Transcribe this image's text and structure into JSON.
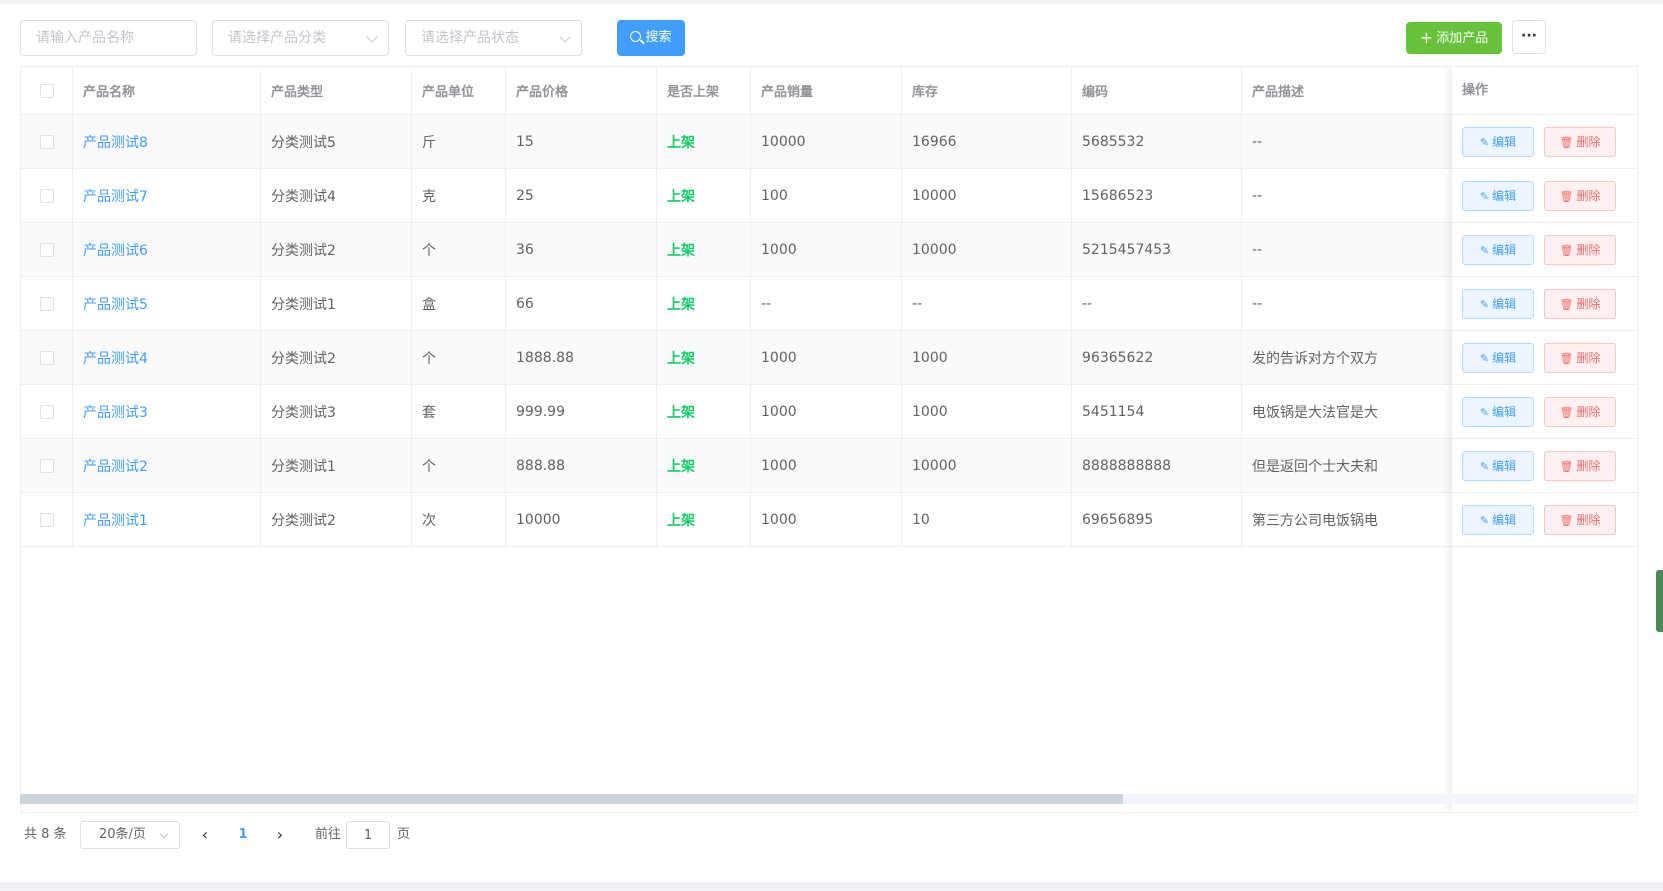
{
  "toolbar": {
    "name_placeholder": "请输入产品名称",
    "category_placeholder": "请选择产品分类",
    "status_placeholder": "请选择产品状态",
    "search_label": "搜索",
    "add_label": "添加产品",
    "more_label": "···"
  },
  "table": {
    "headers": [
      "产品名称",
      "产品类型",
      "产品单位",
      "产品价格",
      "是否上架",
      "产品销量",
      "库存",
      "编码",
      "产品描述",
      "操作"
    ],
    "edit_label": "编辑",
    "delete_label": "删除",
    "rows": [
      {
        "name": "产品测试8",
        "type": "分类测试5",
        "unit": "斤",
        "price": "15",
        "status": "上架",
        "sales": "10000",
        "stock": "16966",
        "code": "5685532",
        "desc": "--"
      },
      {
        "name": "产品测试7",
        "type": "分类测试4",
        "unit": "克",
        "price": "25",
        "status": "上架",
        "sales": "100",
        "stock": "10000",
        "code": "15686523",
        "desc": "--"
      },
      {
        "name": "产品测试6",
        "type": "分类测试2",
        "unit": "个",
        "price": "36",
        "status": "上架",
        "sales": "1000",
        "stock": "10000",
        "code": "5215457453",
        "desc": "--"
      },
      {
        "name": "产品测试5",
        "type": "分类测试1",
        "unit": "盒",
        "price": "66",
        "status": "上架",
        "sales": "--",
        "stock": "--",
        "code": "--",
        "desc": "--"
      },
      {
        "name": "产品测试4",
        "type": "分类测试2",
        "unit": "个",
        "price": "1888.88",
        "status": "上架",
        "sales": "1000",
        "stock": "1000",
        "code": "96365622",
        "desc": "发的告诉对方个双方"
      },
      {
        "name": "产品测试3",
        "type": "分类测试3",
        "unit": "套",
        "price": "999.99",
        "status": "上架",
        "sales": "1000",
        "stock": "1000",
        "code": "5451154",
        "desc": "电饭锅是大法官是大"
      },
      {
        "name": "产品测试2",
        "type": "分类测试1",
        "unit": "个",
        "price": "888.88",
        "status": "上架",
        "sales": "1000",
        "stock": "10000",
        "code": "8888888888",
        "desc": "但是返回个士大夫和"
      },
      {
        "name": "产品测试1",
        "type": "分类测试2",
        "unit": "次",
        "price": "10000",
        "status": "上架",
        "sales": "1000",
        "stock": "10",
        "code": "69656895",
        "desc": "第三方公司电饭锅电"
      }
    ]
  },
  "pagination": {
    "total_label": "共 8 条",
    "page_size_label": "20条/页",
    "current_page": "1",
    "goto_label": "前往",
    "goto_value": "1",
    "goto_suffix": "页"
  },
  "colors": {
    "primary": "#409eff",
    "success": "#67c23a",
    "status_green": "#13ce66",
    "danger": "#f56c6c"
  }
}
